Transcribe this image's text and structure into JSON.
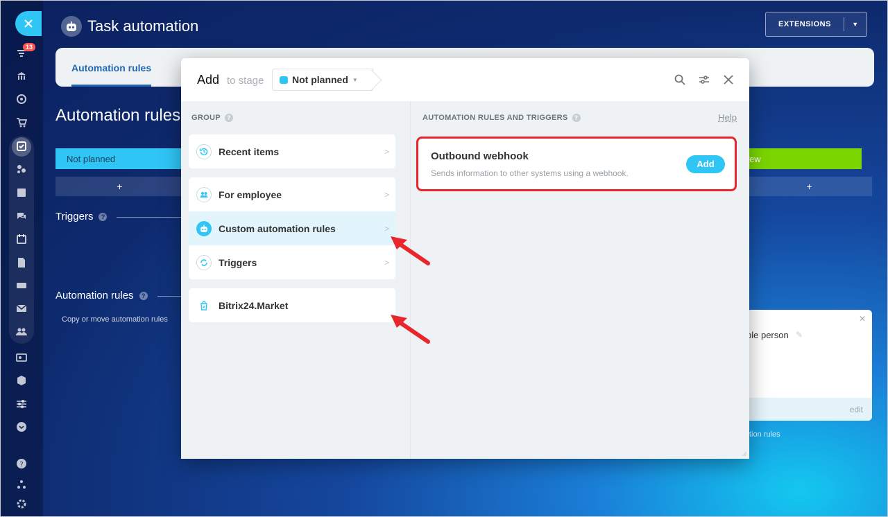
{
  "sidebar": {
    "badge_count": "13"
  },
  "header": {
    "title": "Task automation",
    "extensions_label": "EXTENSIONS"
  },
  "background": {
    "tab_label": "Automation rules",
    "section_title": "Automation rules a",
    "stage_left": "Not planned",
    "stage_right": "ew",
    "plus": "+",
    "triggers_label": "Triggers",
    "automation_rules_label": "Automation rules",
    "copy_move": "Copy or move automation rules",
    "card_text": "ple person",
    "card_edit": "edit",
    "rules_right": "tion rules"
  },
  "dialog": {
    "add_label": "Add",
    "to_stage_label": "to stage",
    "stage_value": "Not planned",
    "group_title": "GROUP",
    "rules_title": "AUTOMATION RULES AND TRIGGERS",
    "help_label": "Help",
    "groups": [
      {
        "label": "Recent items",
        "icon": "history-icon"
      },
      {
        "label": "For employee",
        "icon": "people-icon"
      },
      {
        "label": "Custom automation rules",
        "icon": "robot-icon"
      },
      {
        "label": "Triggers",
        "icon": "trigger-icon"
      },
      {
        "label": "Bitrix24.Market",
        "icon": "market-icon"
      }
    ],
    "webhook": {
      "title": "Outbound webhook",
      "description": "Sends information to other systems using a webhook.",
      "add_label": "Add"
    }
  },
  "colors": {
    "accent": "#2fc6f6",
    "highlight": "#e8262b",
    "stage_green": "#7bd500"
  }
}
